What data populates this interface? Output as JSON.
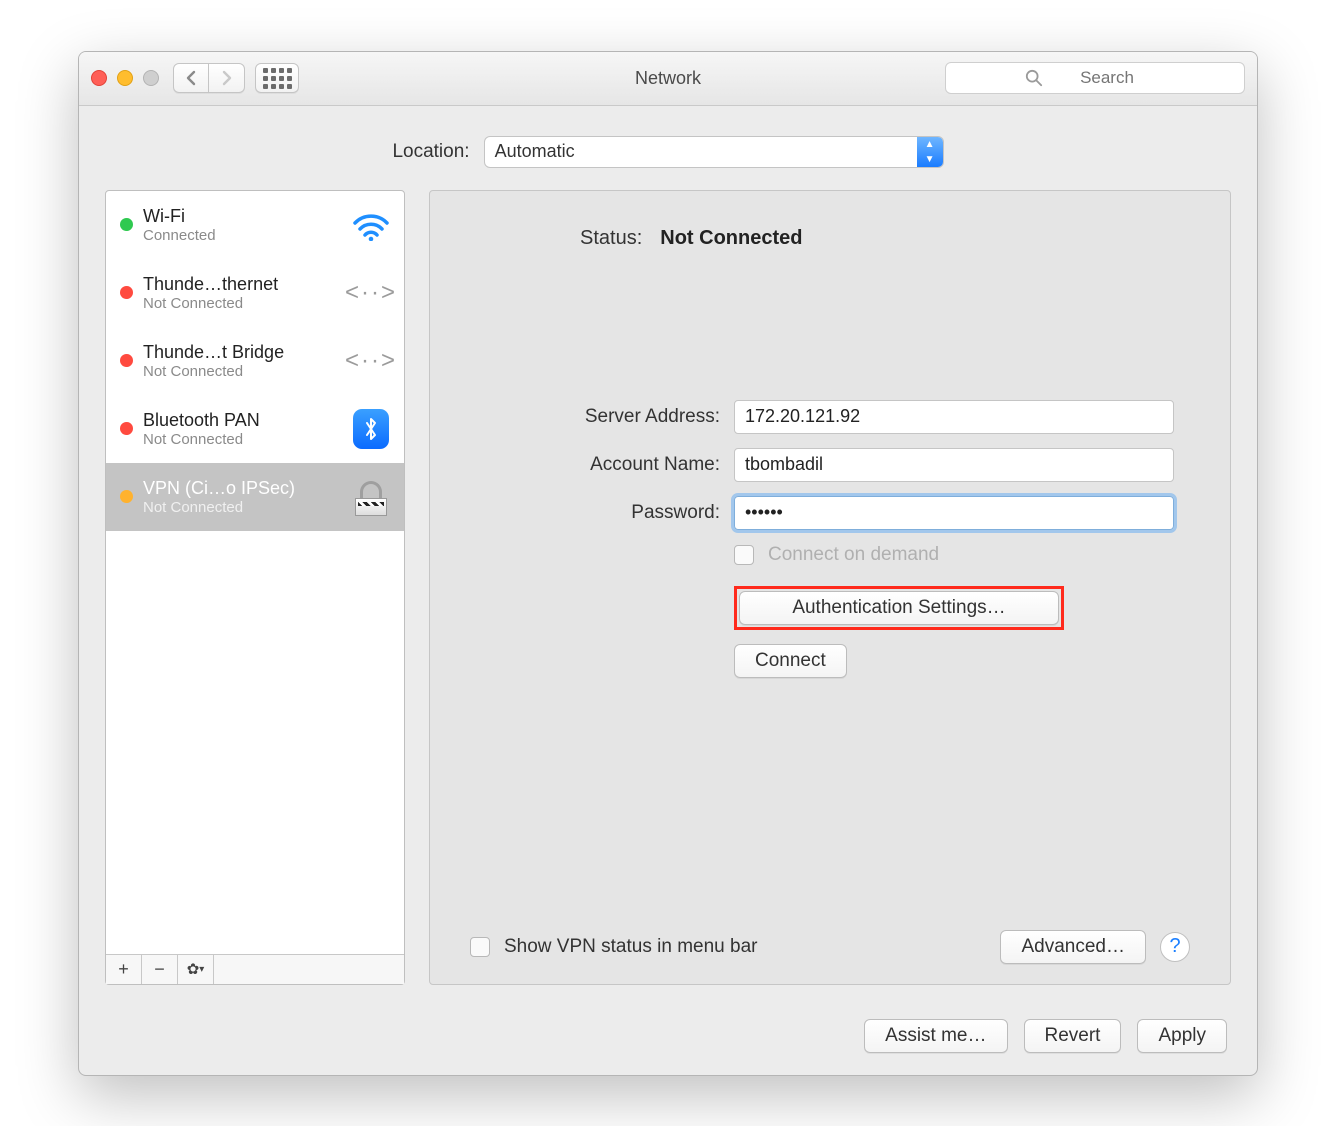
{
  "window": {
    "title": "Network"
  },
  "search": {
    "placeholder": "Search"
  },
  "location": {
    "label": "Location:",
    "value": "Automatic"
  },
  "sidebar": {
    "items": [
      {
        "name": "Wi-Fi",
        "sub": "Connected",
        "dot": "green",
        "icon": "wifi"
      },
      {
        "name": "Thunde…thernet",
        "sub": "Not Connected",
        "dot": "red",
        "icon": "ethernet"
      },
      {
        "name": "Thunde…t Bridge",
        "sub": "Not Connected",
        "dot": "red",
        "icon": "ethernet"
      },
      {
        "name": "Bluetooth PAN",
        "sub": "Not Connected",
        "dot": "red",
        "icon": "bluetooth"
      },
      {
        "name": "VPN (Ci…o IPSec)",
        "sub": "Not Connected",
        "dot": "orange",
        "icon": "vpn",
        "selected": true
      }
    ]
  },
  "main": {
    "status_label": "Status:",
    "status_value": "Not Connected",
    "server_label": "Server Address:",
    "server_value": "172.20.121.92",
    "account_label": "Account Name:",
    "account_value": "tbombadil",
    "password_label": "Password:",
    "password_value": "••••••",
    "connect_on_demand": "Connect on demand",
    "auth_button": "Authentication Settings…",
    "connect_button": "Connect",
    "show_vpn_label": "Show VPN status in menu bar",
    "advanced_button": "Advanced…"
  },
  "footer": {
    "assist": "Assist me…",
    "revert": "Revert",
    "apply": "Apply"
  }
}
